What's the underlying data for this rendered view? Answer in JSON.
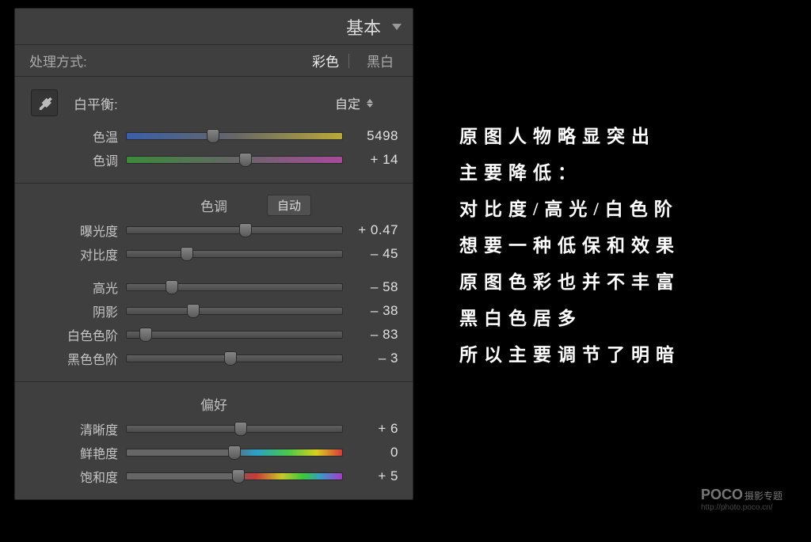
{
  "panel": {
    "title": "基本",
    "treatment": {
      "label": "处理方式:",
      "color": "彩色",
      "bw": "黑白"
    },
    "wb": {
      "label": "白平衡:",
      "selected": "自定"
    },
    "tone_section": {
      "title": "色调",
      "auto": "自动"
    },
    "presence_section": {
      "title": "偏好"
    },
    "sliders": {
      "temp": {
        "label": "色温",
        "value": "5498",
        "pos": 40
      },
      "tint": {
        "label": "色调",
        "value": "+ 14",
        "pos": 55
      },
      "exposure": {
        "label": "曝光度",
        "value": "+ 0.47",
        "pos": 55
      },
      "contrast": {
        "label": "对比度",
        "value": "– 45",
        "pos": 28
      },
      "highlights": {
        "label": "高光",
        "value": "– 58",
        "pos": 21
      },
      "shadows": {
        "label": "阴影",
        "value": "– 38",
        "pos": 31
      },
      "whites": {
        "label": "白色色阶",
        "value": "– 83",
        "pos": 9
      },
      "blacks": {
        "label": "黑色色阶",
        "value": "– 3",
        "pos": 48
      },
      "clarity": {
        "label": "清晰度",
        "value": "+ 6",
        "pos": 53
      },
      "vibrance": {
        "label": "鲜艳度",
        "value": "0",
        "pos": 50
      },
      "saturation": {
        "label": "饱和度",
        "value": "+ 5",
        "pos": 52
      }
    }
  },
  "annotations": {
    "l1": "原图人物略显突出",
    "l2": "主要降低：",
    "l3": "对比度/高光/白色阶",
    "l4": "想要一种低保和效果",
    "l5": "原图色彩也并不丰富",
    "l6": "黑白色居多",
    "l7": "所以主要调节了明暗"
  },
  "watermark": {
    "brand": "POCO",
    "sub": "摄影专题",
    "url": "http://photo.poco.cn/"
  }
}
